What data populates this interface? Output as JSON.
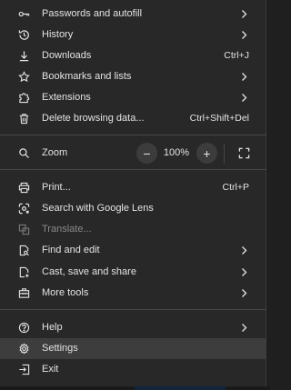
{
  "menu": {
    "items": [
      {
        "label": "Passwords and autofill",
        "icon": "key-icon"
      },
      {
        "label": "History",
        "icon": "history-icon"
      },
      {
        "label": "Downloads",
        "shortcut": "Ctrl+J",
        "icon": "download-icon"
      },
      {
        "label": "Bookmarks and lists",
        "icon": "star-icon"
      },
      {
        "label": "Extensions",
        "icon": "puzzle-icon"
      },
      {
        "label": "Delete browsing data...",
        "shortcut": "Ctrl+Shift+Del",
        "icon": "trash-icon"
      }
    ],
    "zoom": {
      "label": "Zoom",
      "minus": "−",
      "value": "100%",
      "plus": "+",
      "icon": "zoom-icon"
    },
    "items2": [
      {
        "label": "Print...",
        "shortcut": "Ctrl+P",
        "icon": "printer-icon"
      },
      {
        "label": "Search with Google Lens",
        "icon": "lens-icon"
      },
      {
        "label": "Translate...",
        "icon": "translate-icon",
        "disabled": true
      },
      {
        "label": "Find and edit",
        "icon": "find-icon"
      },
      {
        "label": "Cast, save and share",
        "icon": "cast-icon"
      },
      {
        "label": "More tools",
        "icon": "toolbox-icon"
      }
    ],
    "items3": [
      {
        "label": "Help",
        "icon": "help-icon"
      },
      {
        "label": "Settings",
        "icon": "gear-icon",
        "highlighted": true
      },
      {
        "label": "Exit",
        "icon": "exit-icon"
      }
    ]
  },
  "colors": {
    "background": "#282828",
    "text": "#e3e3e3",
    "disabled": "#8a8a8a",
    "highlight": "#3d3d3d"
  }
}
